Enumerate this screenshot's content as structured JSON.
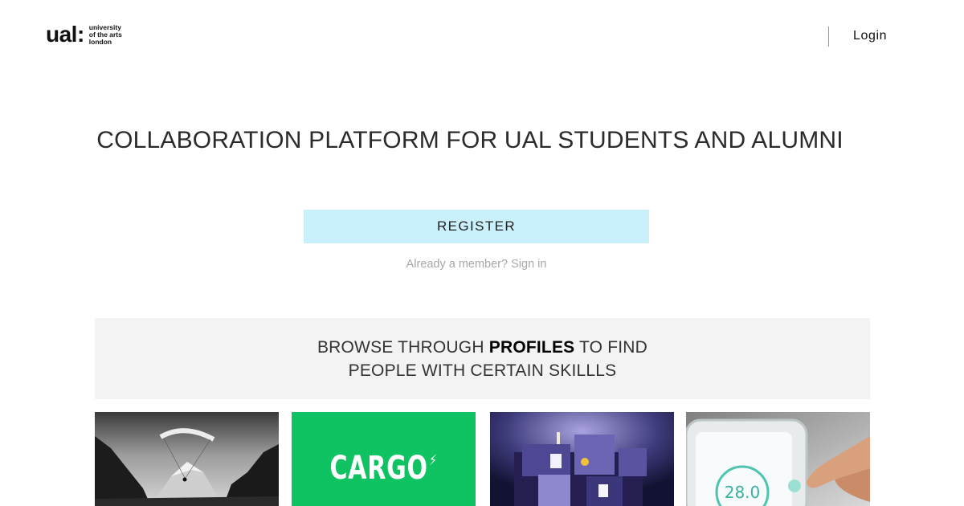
{
  "header": {
    "logo_mark": "ual:",
    "logo_lines": [
      "university",
      "of the arts",
      "london"
    ],
    "login_label": "Login"
  },
  "hero": {
    "headline": "COLLABORATION PLATFORM FOR UAL STUDENTS AND ALUMNI",
    "register_label": "REGISTER",
    "signin_prefix": "Already a member?",
    "signin_link": "Sign in"
  },
  "browse": {
    "line1_before": "BROWSE THROUGH",
    "line1_bold": "PROFILES",
    "line1_after": "TO FIND",
    "line2": "PEOPLE WITH CERTAIN SKILLLS"
  },
  "cards": [
    {
      "name": "paraglider-photo"
    },
    {
      "name": "cargo-logo",
      "logo_text": "CARGO",
      "logo_symbol": "⚡",
      "color": "#0fc262"
    },
    {
      "name": "illuminated-sculpture-photo"
    },
    {
      "name": "thermostat-photo",
      "display_value": "28.0"
    }
  ],
  "colors": {
    "register_bg": "#caf0fc",
    "panel_bg": "#f3f3f3",
    "muted_text": "#a8a8a8"
  }
}
